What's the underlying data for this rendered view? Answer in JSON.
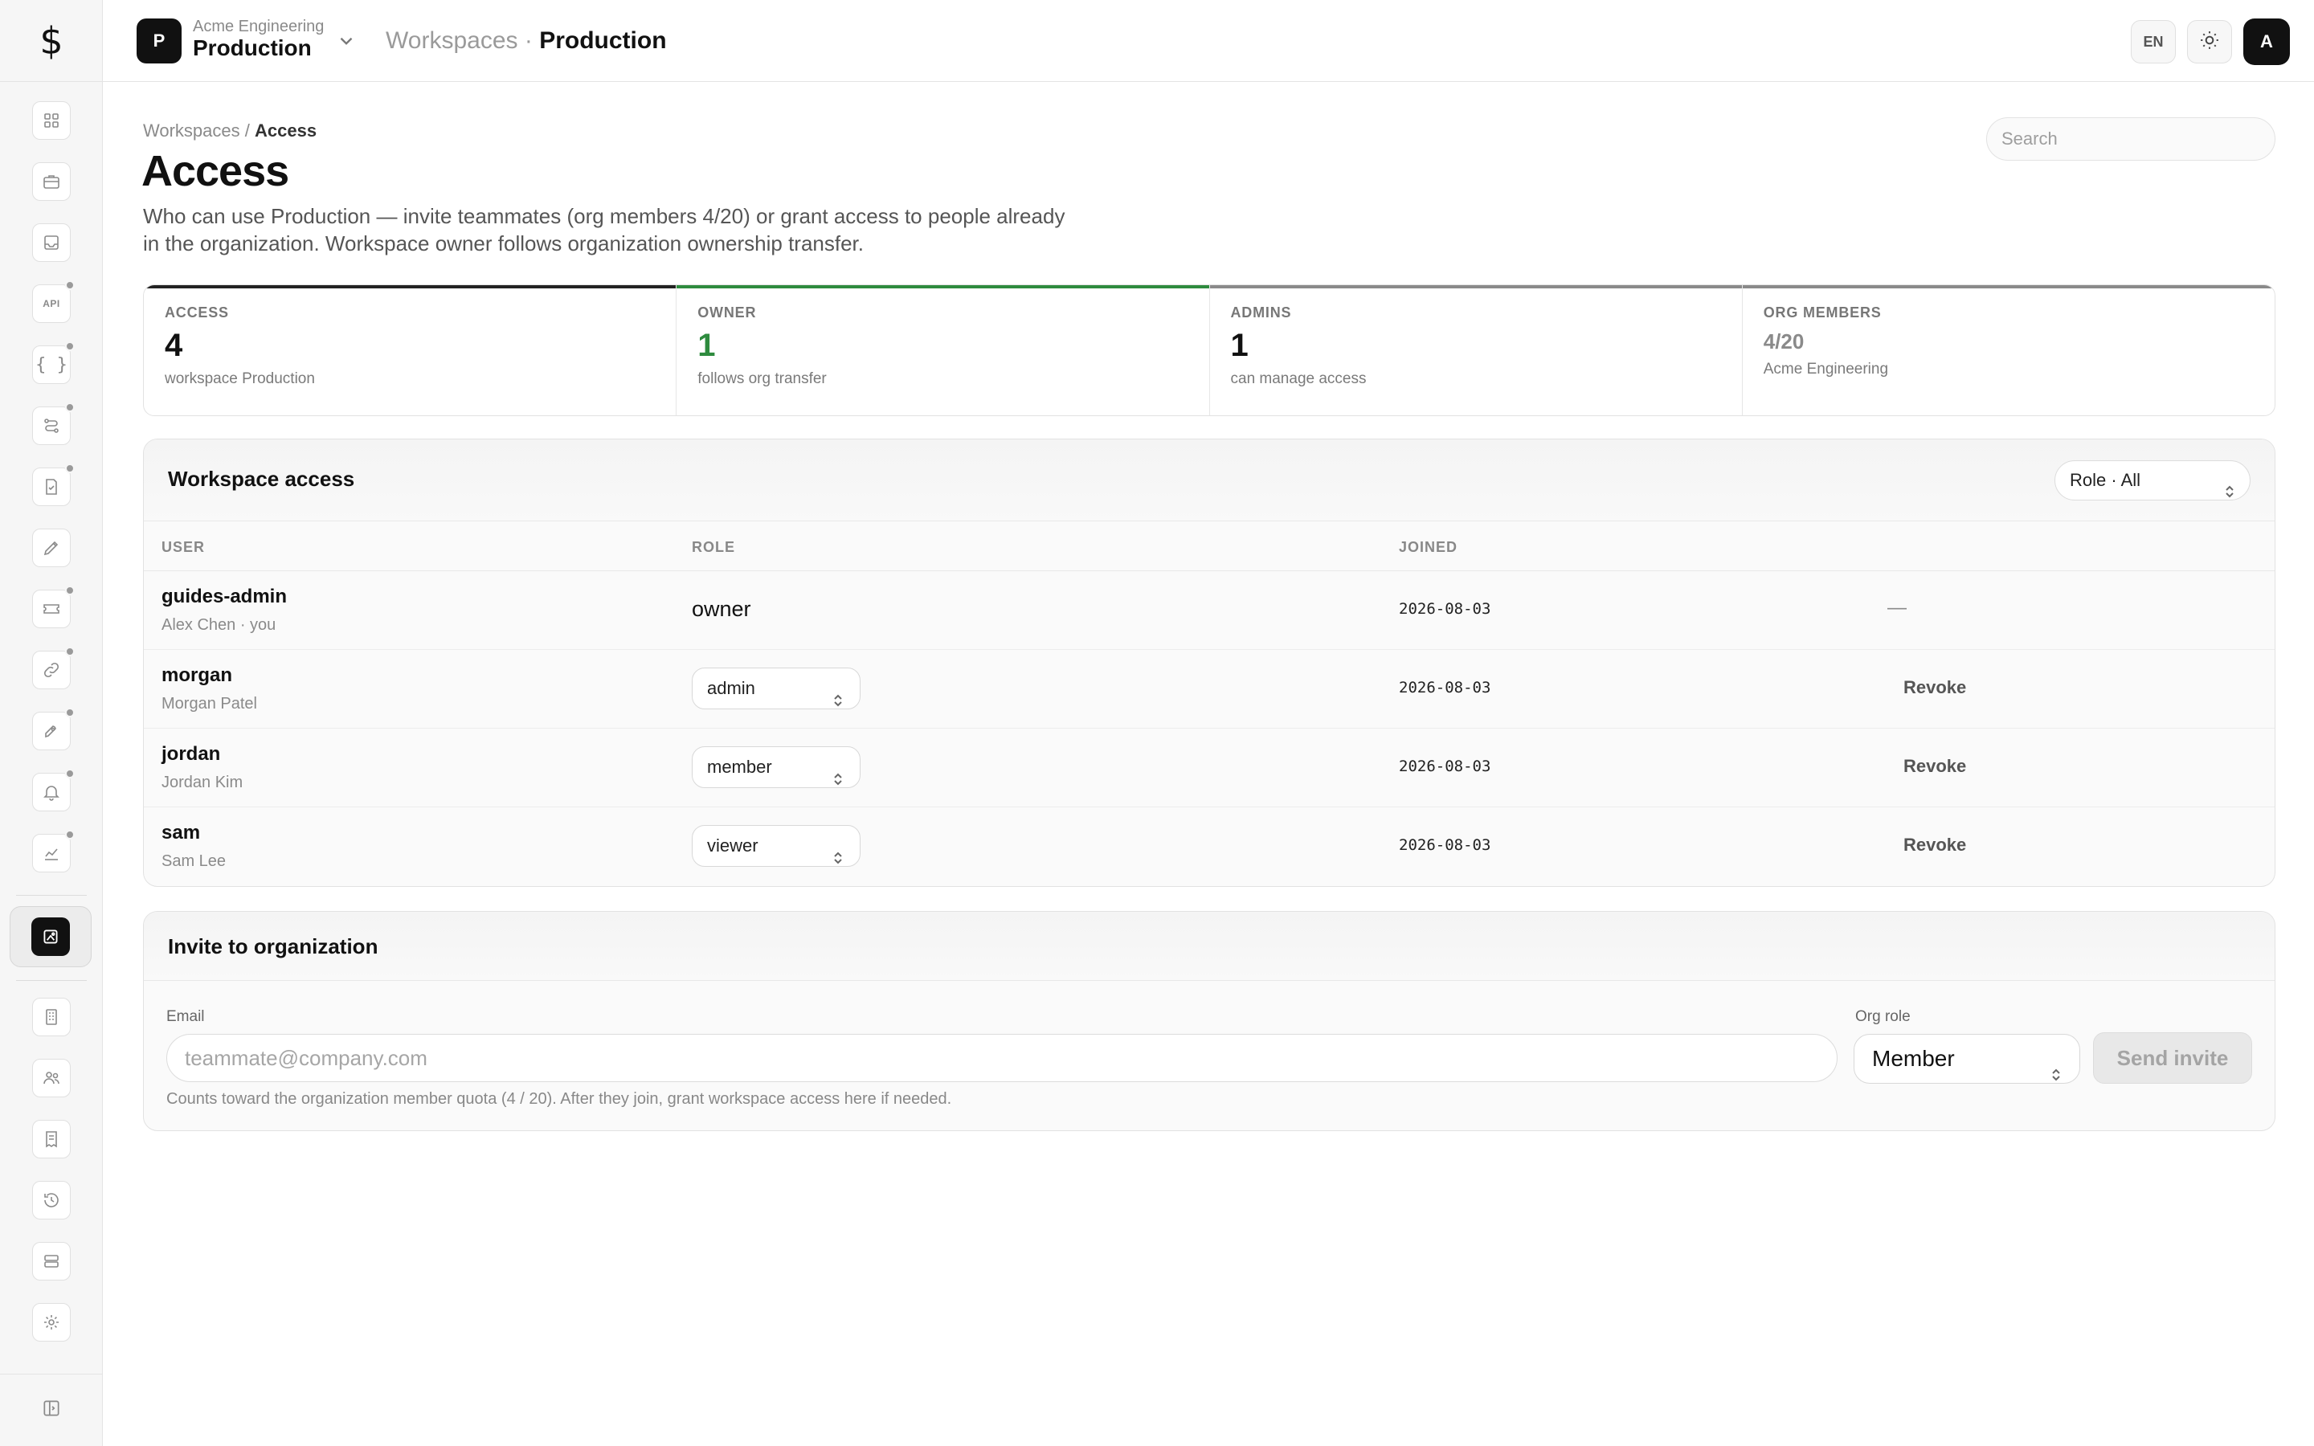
{
  "app": {
    "logo_glyph": "$"
  },
  "workspace": {
    "org": "Acme Engineering",
    "name": "Production",
    "badge": "P"
  },
  "topbar": {
    "crumb_parent": "Workspaces",
    "crumb_sep": "·",
    "crumb_current": "Production",
    "lang": "EN",
    "avatar": "A"
  },
  "rail": {
    "items": [
      {
        "icon": "dashboard-icon",
        "dot": false
      },
      {
        "icon": "briefcase-icon",
        "dot": false
      },
      {
        "icon": "inbox-icon",
        "dot": false
      },
      {
        "icon": "api-icon",
        "label": "API",
        "dot": true
      },
      {
        "icon": "code-braces-icon",
        "dot": true
      },
      {
        "icon": "routes-icon",
        "dot": true
      },
      {
        "icon": "document-check-icon",
        "dot": true
      },
      {
        "icon": "pen-tool-icon",
        "dot": false
      },
      {
        "icon": "ticket-icon",
        "dot": true
      },
      {
        "icon": "link-icon",
        "dot": true
      },
      {
        "icon": "rocket-icon",
        "dot": true
      },
      {
        "icon": "bell-icon",
        "dot": true
      },
      {
        "icon": "chart-icon",
        "dot": true
      }
    ],
    "active": {
      "icon": "workspace-access-icon"
    },
    "lower": [
      {
        "icon": "building-icon"
      },
      {
        "icon": "users-icon"
      },
      {
        "icon": "receipt-icon"
      },
      {
        "icon": "history-icon"
      },
      {
        "icon": "storage-icon"
      },
      {
        "icon": "settings-icon"
      }
    ],
    "bottom": {
      "icon": "sidebar-toggle-icon"
    }
  },
  "page": {
    "breadcrumb_parent": "Workspaces",
    "breadcrumb_sep": "/",
    "breadcrumb_current": "Access",
    "title": "Access",
    "description": "Who can use Production — invite teammates (org members 4/20) or grant access to people already in the organization. Workspace owner follows organization ownership transfer.",
    "search_placeholder": "Search"
  },
  "stats": [
    {
      "label": "ACCESS",
      "value": "4",
      "sub": "workspace Production",
      "bar_color": "#222222",
      "value_color": "#111111"
    },
    {
      "label": "OWNER",
      "value": "1",
      "sub": "follows org transfer",
      "bar_color": "#2e8b3e",
      "value_color": "#2e8b3e"
    },
    {
      "label": "ADMINS",
      "value": "1",
      "sub": "can manage access",
      "bar_color": "#8a8a8a",
      "value_color": "#111111"
    },
    {
      "label": "ORG MEMBERS",
      "value": "4/20",
      "sub": "Acme Engineering",
      "bar_color": "#8a8a8a",
      "value_color": "#8a8a8a"
    }
  ],
  "access_panel": {
    "title": "Workspace access",
    "filter_label": "Role · All",
    "columns": {
      "user": "USER",
      "role": "ROLE",
      "joined": "JOINED"
    },
    "rows": [
      {
        "username": "guides-admin",
        "fullname": "Alex Chen · you",
        "role": "owner",
        "editable": false,
        "joined": "2026-08-03",
        "action": "—"
      },
      {
        "username": "morgan",
        "fullname": "Morgan Patel",
        "role": "admin",
        "editable": true,
        "joined": "2026-08-03",
        "action": "Revoke"
      },
      {
        "username": "jordan",
        "fullname": "Jordan Kim",
        "role": "member",
        "editable": true,
        "joined": "2026-08-03",
        "action": "Revoke"
      },
      {
        "username": "sam",
        "fullname": "Sam Lee",
        "role": "viewer",
        "editable": true,
        "joined": "2026-08-03",
        "action": "Revoke"
      }
    ]
  },
  "invite_panel": {
    "title": "Invite to organization",
    "email_label": "Email",
    "email_placeholder": "teammate@company.com",
    "org_role_label": "Org role",
    "org_role_value": "Member",
    "send_label": "Send invite",
    "hint": "Counts toward the organization member quota (4 / 20). After they join, grant workspace access here if needed."
  }
}
